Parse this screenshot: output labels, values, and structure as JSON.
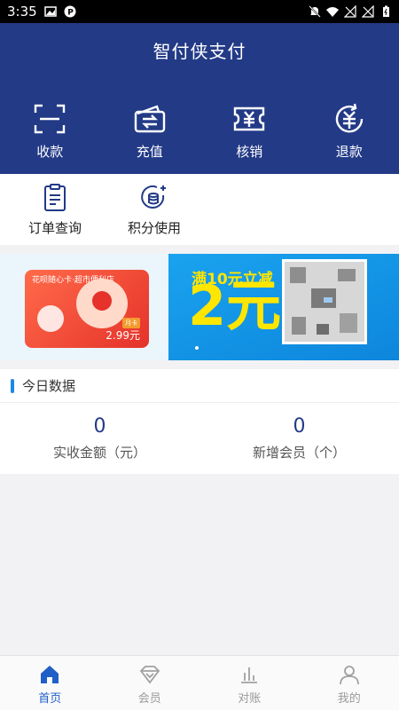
{
  "status_bar": {
    "time": "3:35",
    "icons_left": [
      "image-icon",
      "p-icon"
    ],
    "icons_right": [
      "mute-icon",
      "wifi-icon",
      "signal-icon",
      "signal-icon",
      "battery-icon"
    ]
  },
  "header": {
    "title": "智付侠支付",
    "background": "#233a87",
    "actions": [
      {
        "label": "收款",
        "icon": "scan-icon"
      },
      {
        "label": "充值",
        "icon": "wallet-icon"
      },
      {
        "label": "核销",
        "icon": "ticket-icon"
      },
      {
        "label": "退款",
        "icon": "refund-icon"
      }
    ]
  },
  "quick_menu": [
    {
      "label": "订单查询",
      "icon": "order-list-icon"
    },
    {
      "label": "积分使用",
      "icon": "points-icon"
    }
  ],
  "banner": {
    "card_text": "花呗随心卡·超市便利店",
    "card_price": "2.99元",
    "card_tag": "月卡",
    "promo_line": "满10元立减",
    "promo_big": "2元",
    "pages": 1
  },
  "today_data": {
    "title": "今日数据",
    "stats": [
      {
        "value": "0",
        "label": "实收金额（元）"
      },
      {
        "value": "0",
        "label": "新增会员（个）"
      }
    ]
  },
  "tabbar": {
    "active_color": "#1f5fc6",
    "items": [
      {
        "label": "首页",
        "icon": "home-icon",
        "active": true
      },
      {
        "label": "会员",
        "icon": "diamond-icon",
        "active": false
      },
      {
        "label": "对账",
        "icon": "bar-chart-icon",
        "active": false
      },
      {
        "label": "我的",
        "icon": "user-icon",
        "active": false
      }
    ]
  }
}
